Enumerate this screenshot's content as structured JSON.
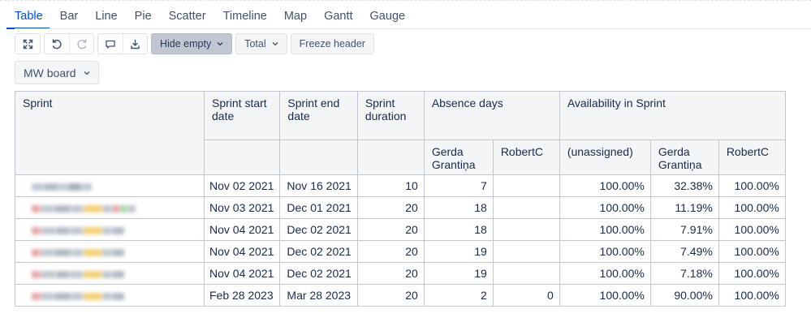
{
  "tabs": [
    "Table",
    "Bar",
    "Line",
    "Pie",
    "Scatter",
    "Timeline",
    "Map",
    "Gantt",
    "Gauge"
  ],
  "toolbar": {
    "hide_empty": "Hide empty",
    "total": "Total",
    "freeze_header": "Freeze header"
  },
  "board_select": "MW board",
  "table": {
    "headers": {
      "sprint": "Sprint",
      "start": "Sprint start date",
      "end": "Sprint end date",
      "duration": "Sprint duration",
      "absence": "Absence days",
      "availability": "Availability in Sprint"
    },
    "sub_headers": {
      "absence_gerda": "Gerda Grantiņa",
      "absence_robert": "RobertC",
      "avail_unassigned": "(unassigned)",
      "avail_gerda": "Gerda Grantiņa",
      "avail_robert": "RobertC"
    },
    "rows": [
      {
        "start": "Nov 02 2021",
        "end": "Nov 16 2021",
        "duration": "10",
        "abs_gerda": "7",
        "abs_robert": "",
        "av_unassigned": "100.00%",
        "av_gerda": "32.38%",
        "av_robert": "100.00%"
      },
      {
        "start": "Nov 03 2021",
        "end": "Dec 01 2021",
        "duration": "20",
        "abs_gerda": "18",
        "abs_robert": "",
        "av_unassigned": "100.00%",
        "av_gerda": "11.19%",
        "av_robert": "100.00%"
      },
      {
        "start": "Nov 04 2021",
        "end": "Dec 02 2021",
        "duration": "20",
        "abs_gerda": "18",
        "abs_robert": "",
        "av_unassigned": "100.00%",
        "av_gerda": "7.91%",
        "av_robert": "100.00%"
      },
      {
        "start": "Nov 04 2021",
        "end": "Dec 02 2021",
        "duration": "20",
        "abs_gerda": "19",
        "abs_robert": "",
        "av_unassigned": "100.00%",
        "av_gerda": "7.49%",
        "av_robert": "100.00%"
      },
      {
        "start": "Nov 04 2021",
        "end": "Dec 02 2021",
        "duration": "20",
        "abs_gerda": "19",
        "abs_robert": "",
        "av_unassigned": "100.00%",
        "av_gerda": "7.18%",
        "av_robert": "100.00%"
      },
      {
        "start": "Feb 28 2023",
        "end": "Mar 28 2023",
        "duration": "20",
        "abs_gerda": "2",
        "abs_robert": "0",
        "av_unassigned": "100.00%",
        "av_gerda": "90.00%",
        "av_robert": "100.00%"
      }
    ]
  },
  "icons": {
    "expand": "expand-icon",
    "undo": "undo-icon",
    "redo": "redo-icon",
    "comment": "comment-icon",
    "download": "download-icon"
  }
}
